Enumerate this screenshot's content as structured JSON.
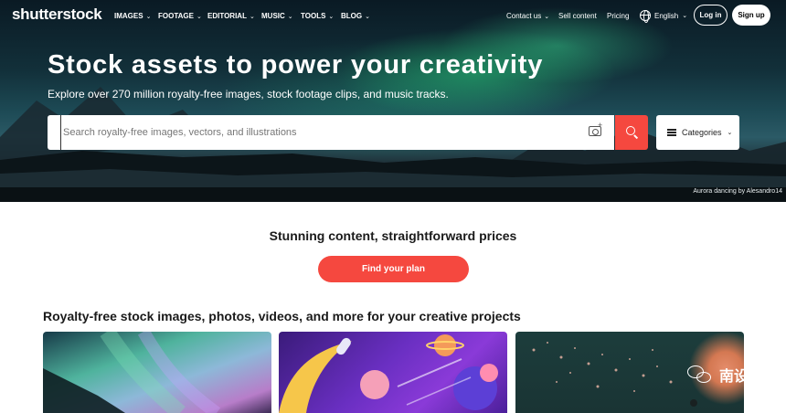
{
  "header": {
    "logo": "shutterstock",
    "nav": [
      {
        "label": "IMAGES"
      },
      {
        "label": "FOOTAGE"
      },
      {
        "label": "EDITORIAL"
      },
      {
        "label": "MUSIC"
      },
      {
        "label": "TOOLS"
      },
      {
        "label": "BLOG"
      }
    ],
    "contact_label": "Contact us",
    "sell_label": "Sell content",
    "pricing_label": "Pricing",
    "language": "English",
    "login_label": "Log in",
    "signup_label": "Sign up"
  },
  "hero": {
    "title": "Stock assets to power your creativity",
    "subtitle": "Explore over 270 million royalty-free images, stock footage clips, and music tracks.",
    "search_placeholder": "Search royalty-free images, vectors, and illustrations",
    "categories_label": "Categories",
    "credit": "Aurora dancing by Alesandro14"
  },
  "pricing": {
    "title": "Stunning content, straightforward prices",
    "button_label": "Find your plan"
  },
  "collections": {
    "title": "Royalty-free stock images, photos, videos, and more for your creative projects"
  },
  "watermark": {
    "text": "南设"
  },
  "icons": {
    "search": "search-icon",
    "camera": "camera-search-icon",
    "globe": "globe-icon",
    "list": "list-icon",
    "chevron": "chevron-down-icon"
  },
  "colors": {
    "accent": "#f5483f",
    "text_dark": "#1a1a1a"
  }
}
